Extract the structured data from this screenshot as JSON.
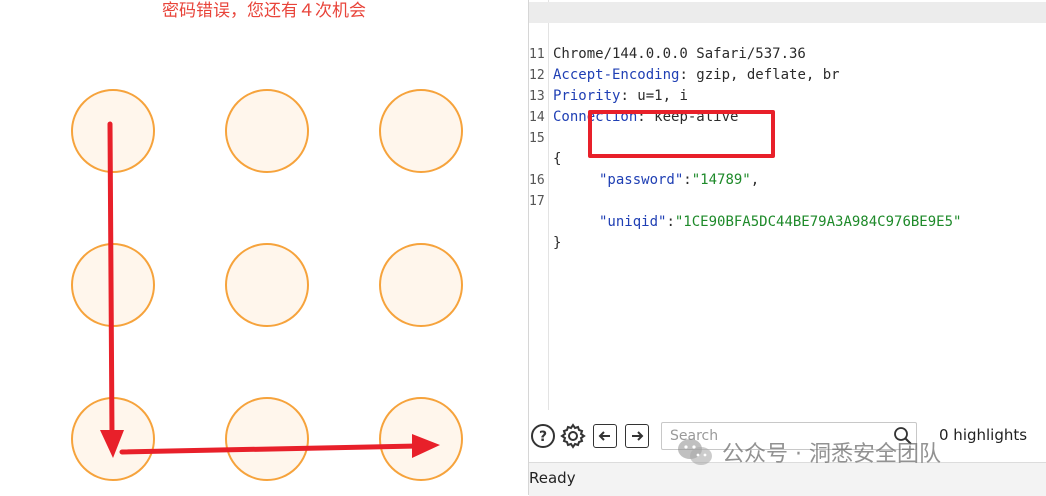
{
  "pattern_lock": {
    "error_message": "密码错误，您还有４次机会",
    "colors": {
      "ring": "#f6a33c",
      "fill": "#fff6ec",
      "annotation": "#e8202a",
      "error_text": "#e8443a"
    }
  },
  "editor": {
    "lines": [
      {
        "num": "",
        "text": "Chrome/144.0.0.0 Safari/537.36"
      },
      {
        "num": "11",
        "key": "Accept-Encoding",
        "value": " gzip, deflate, br"
      },
      {
        "num": "12",
        "key": "Priority",
        "value": " u=1, i"
      },
      {
        "num": "13",
        "key": "Connection",
        "value": " keep-alive"
      },
      {
        "num": "14",
        "text": ""
      },
      {
        "num": "15",
        "text": "{"
      },
      {
        "num": "",
        "json_key": "\"password\"",
        "json_val": "\"14789\""
      },
      {
        "num": "16",
        "text": ""
      },
      {
        "num": "17",
        "json_key": "\"uniqid\"",
        "json_val": "\"1CE90BFA5DC44BE79A3A984C976BE9E5\""
      },
      {
        "num": "",
        "text": "}"
      }
    ]
  },
  "toolbar": {
    "help_icon": "help-circle-icon",
    "settings_icon": "gear-icon",
    "prev_icon": "arrow-left-icon",
    "next_icon": "arrow-right-icon",
    "search_placeholder": "Search",
    "search_icon": "magnifier-icon",
    "highlights_label": "0 highlights"
  },
  "status": {
    "text": "Ready"
  },
  "watermark": {
    "text": "公众号 · 洞悉安全团队",
    "icon": "wechat-icon"
  }
}
